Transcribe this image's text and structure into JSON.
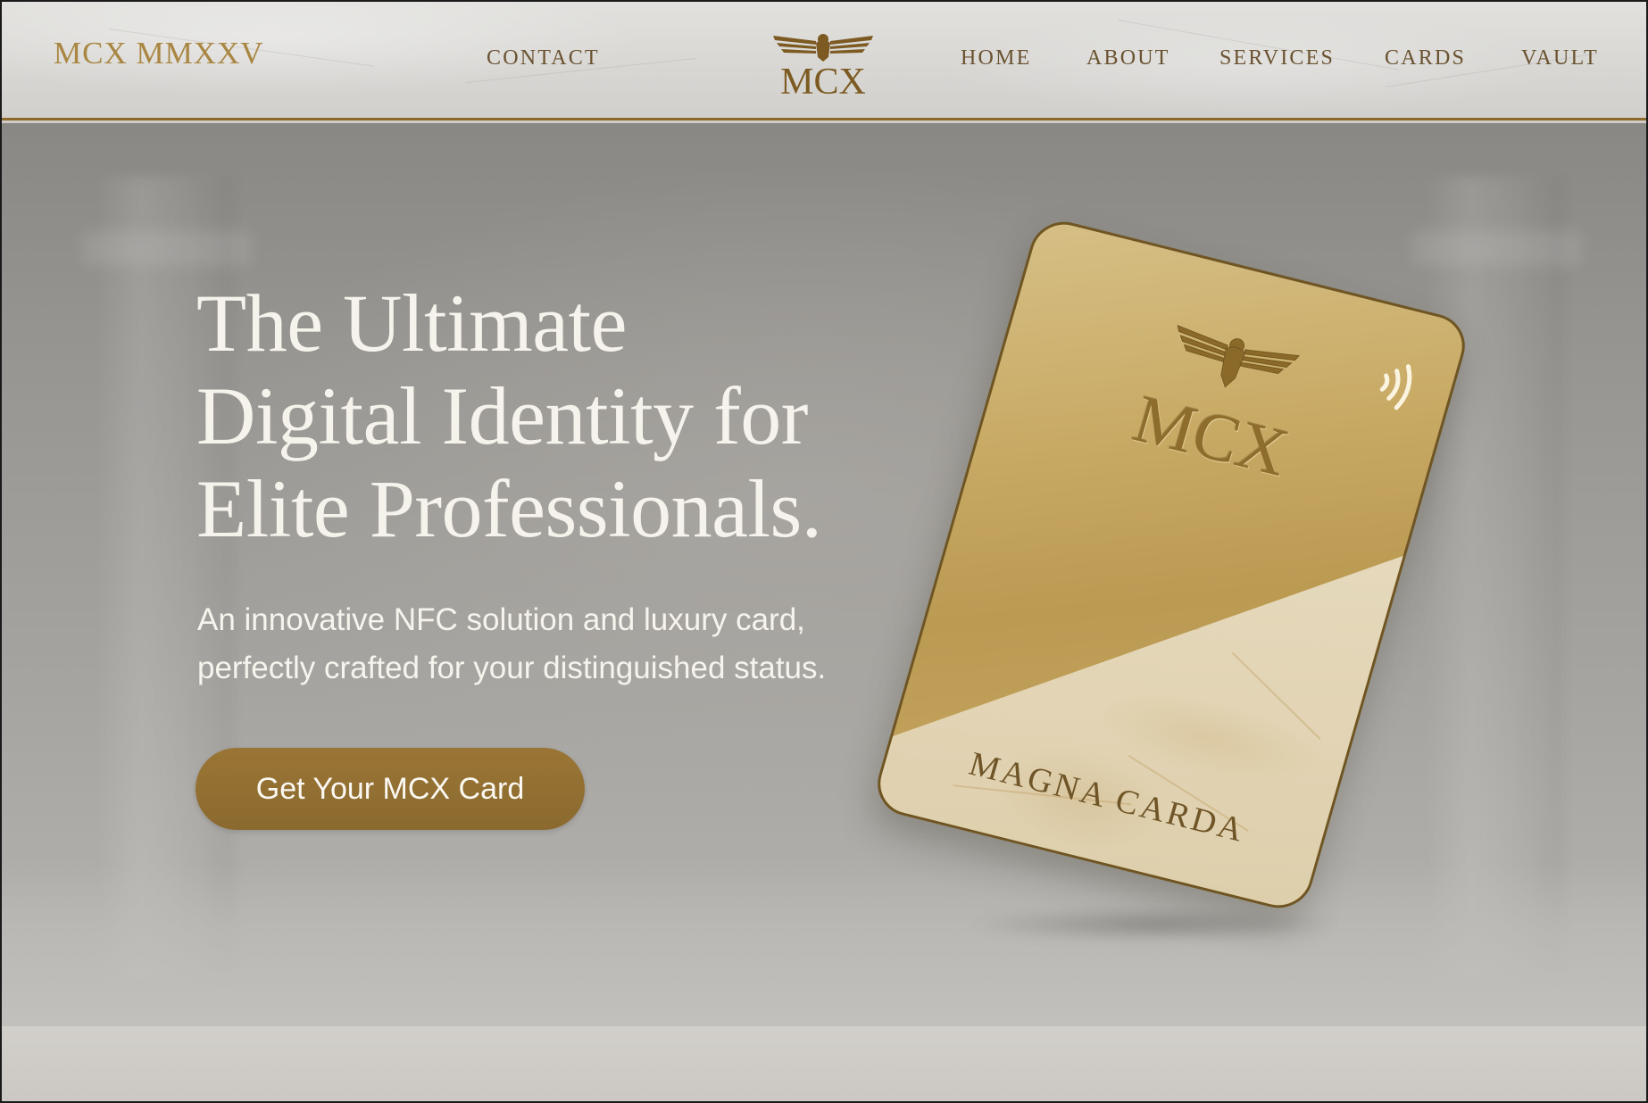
{
  "header": {
    "brand": "MCX MMXXV",
    "logo_text": "MCX",
    "nav": {
      "contact": "CONTACT",
      "home": "HOME",
      "about": "ABOUT",
      "services": "SERVICES",
      "cards": "CARDS",
      "vault": "VAULT"
    }
  },
  "hero": {
    "headline_line1": "The Ultimate",
    "headline_line2": "Digital Identity for",
    "headline_line3": "Elite Professionals.",
    "subtitle_line1": "An innovative NFC solution and luxury card,",
    "subtitle_line2": "perfectly crafted for your distinguished status.",
    "cta_label": "Get Your MCX Card"
  },
  "card": {
    "logo_text": "MCX",
    "name_text": "MAGNA CARDA",
    "icons": [
      "eagle-icon",
      "nfc-icon"
    ]
  },
  "colors": {
    "gold": "#8b6a2f",
    "gold_text": "#a98642",
    "nav_text": "#6a5230",
    "hero_text": "#f6f3ec"
  }
}
